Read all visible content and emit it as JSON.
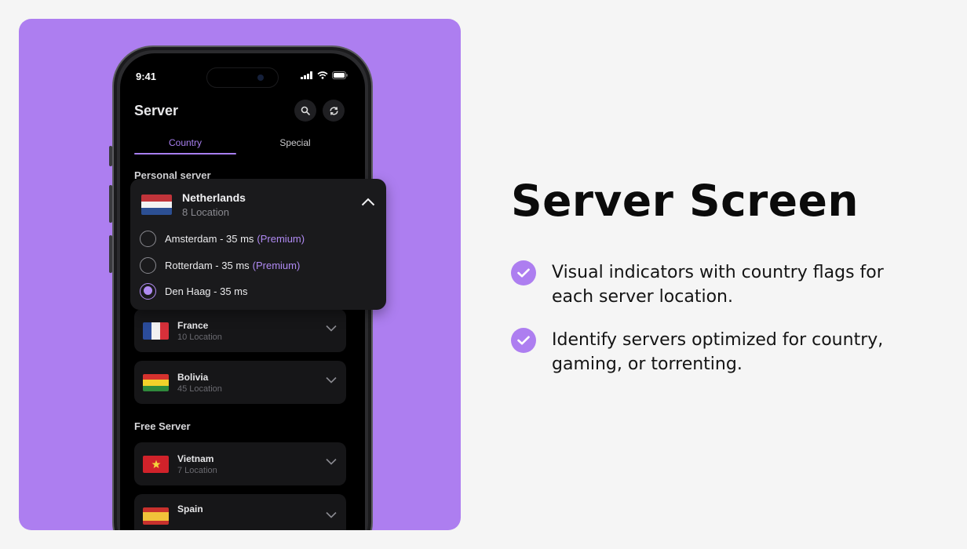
{
  "phone": {
    "status_time": "9:41",
    "app_title": "Server",
    "tabs": [
      {
        "label": "Country",
        "active": true
      },
      {
        "label": "Special",
        "active": false
      }
    ],
    "sections": {
      "personal": "Personal server",
      "free": "Free Server"
    },
    "expanded_country": {
      "name": "Netherlands",
      "sub": "8 Location",
      "options": [
        {
          "text": "Amsterdam - 35 ms",
          "premium": "(Premium)",
          "checked": false
        },
        {
          "text": "Rotterdam - 35 ms",
          "premium": "(Premium)",
          "checked": false
        },
        {
          "text": "Den Haag - 35 ms",
          "premium": "",
          "checked": true
        }
      ]
    },
    "countries": [
      {
        "name": "France",
        "sub": "10 Location",
        "icon": "flag-france"
      },
      {
        "name": "Bolivia",
        "sub": "45 Location",
        "icon": "flag-bolivia"
      }
    ],
    "free_countries": [
      {
        "name": "Vietnam",
        "sub": "7 Location",
        "icon": "flag-vietnam"
      },
      {
        "name": "Spain",
        "sub": "",
        "icon": "flag-spain"
      }
    ]
  },
  "marketing": {
    "headline": "Server Screen",
    "bullets": [
      "Visual indicators with country flags for each server location.",
      "Identify servers optimized for country, gaming, or torrenting."
    ]
  },
  "colors": {
    "accent": "#ad7ef0",
    "background": "#f5f5f5",
    "phone_screen": "#000000"
  }
}
